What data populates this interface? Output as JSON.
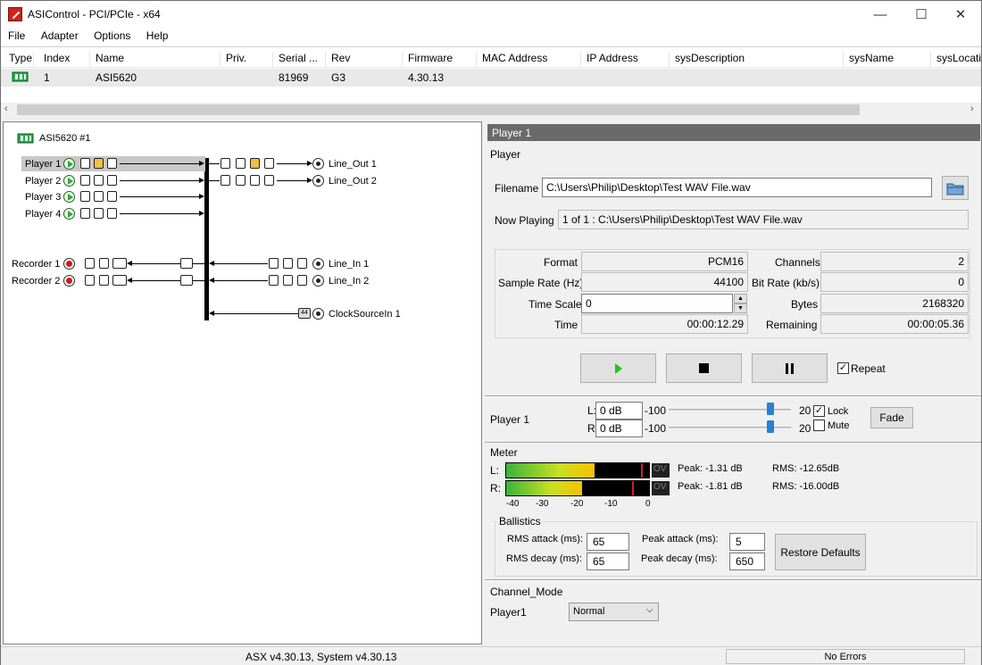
{
  "window": {
    "title": "ASIControl - PCI/PCIe - x64",
    "minimize": "—",
    "maximize": "☐",
    "close": "✕"
  },
  "menu": [
    "File",
    "Adapter",
    "Options",
    "Help"
  ],
  "device_table": {
    "columns": [
      "Type",
      "Index",
      "Name",
      "Priv.",
      "Serial ...",
      "Rev",
      "Firmware",
      "MAC Address",
      "IP Address",
      "sysDescription",
      "sysName",
      "sysLocati"
    ],
    "rows": [
      {
        "index": "1",
        "name": "ASI5620",
        "priv": "",
        "serial": "81969",
        "rev": "G3",
        "firmware": "4.30.13"
      }
    ]
  },
  "tree": {
    "adapter": "ASI5620 #1",
    "players": [
      "Player  1",
      "Player  2",
      "Player  3",
      "Player  4"
    ],
    "outputs": [
      "Line_Out  1",
      "Line_Out  2"
    ],
    "recorders": [
      "Recorder  1",
      "Recorder  2"
    ],
    "inputs": [
      "Line_In  1",
      "Line_In  2"
    ],
    "clock": "ClockSourceIn  1",
    "clock_badge": "44"
  },
  "player": {
    "header": "Player  1",
    "section": "Player",
    "filename_label": "Filename",
    "filename": "C:\\Users\\Philip\\Desktop\\Test WAV File.wav",
    "now_playing_label": "Now Playing",
    "now_playing": "1 of 1 : C:\\Users\\Philip\\Desktop\\Test WAV File.wav",
    "format_label": "Format",
    "format": "PCM16",
    "channels_label": "Channels",
    "channels": "2",
    "sample_rate_label": "Sample Rate (Hz)",
    "sample_rate": "44100",
    "bitrate_label": "Bit Rate (kb/s)",
    "bitrate": "0",
    "timescale_label": "Time Scale",
    "timescale": "0",
    "bytes_label": "Bytes",
    "bytes": "2168320",
    "time_label": "Time",
    "time": "00:00:12.29",
    "remaining_label": "Remaining",
    "remaining": "00:00:05.36",
    "repeat_label": "Repeat",
    "repeat_checked": true
  },
  "volume": {
    "label": "Player  1",
    "l_label": "L:",
    "l_value": "0 dB",
    "r_label": "R:",
    "r_value": "0 dB",
    "min": "-100",
    "max": "20",
    "level_fraction": 0.83,
    "lock_label": "Lock",
    "lock_checked": true,
    "mute_label": "Mute",
    "mute_checked": false,
    "fade_label": "Fade"
  },
  "meter": {
    "section": "Meter",
    "l_label": "L:",
    "r_label": "R:",
    "ov_label": "OV",
    "l_peak": "Peak: -1.31 dB",
    "l_rms": "RMS: -12.65dB",
    "r_peak": "Peak: -1.81 dB",
    "r_rms": "RMS: -16.00dB",
    "l_level_fraction": 0.62,
    "r_level_fraction": 0.53,
    "scale": [
      "-40",
      "-30",
      "-20",
      "-10",
      "0"
    ]
  },
  "ballistics": {
    "section": "Ballistics",
    "rms_attack_label": "RMS attack (ms):",
    "rms_attack": "65",
    "rms_decay_label": "RMS decay (ms):",
    "rms_decay": "65",
    "peak_attack_label": "Peak attack (ms):",
    "peak_attack": "5",
    "peak_decay_label": "Peak decay (ms):",
    "peak_decay": "650",
    "restore_label": "Restore Defaults"
  },
  "channel_mode": {
    "section": "Channel_Mode",
    "label": "Player1",
    "value": "Normal"
  },
  "status": {
    "version": "ASX v4.30.13, System v4.30.13",
    "errors": "No Errors"
  }
}
